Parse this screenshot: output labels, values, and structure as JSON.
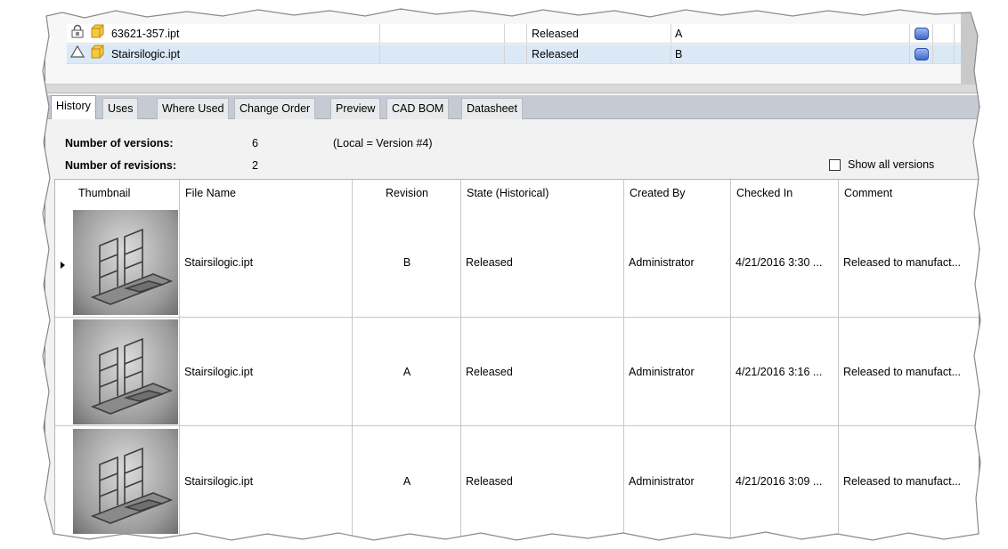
{
  "top_list": {
    "rows": [
      {
        "name": "63621-357.ipt",
        "state": "Released",
        "revision": "A",
        "lock_icon": "lock-icon",
        "file_icon": "cube-icon"
      },
      {
        "name": "Stairsilogic.ipt",
        "state": "Released",
        "revision": "B",
        "status_icon": "triangle-icon",
        "file_icon": "cube-icon"
      }
    ]
  },
  "tabs": [
    "History",
    "Uses",
    "Where Used",
    "Change Order",
    "Preview",
    "CAD BOM",
    "Datasheet"
  ],
  "history": {
    "versions_label": "Number of versions:",
    "versions_value": "6",
    "local_note": "(Local = Version #4)",
    "revisions_label": "Number of revisions:",
    "revisions_value": "2",
    "show_all_label": "Show all versions",
    "show_all_checked": false
  },
  "grid": {
    "columns": [
      "Thumbnail",
      "File Name",
      "Revision",
      "State (Historical)",
      "Created By",
      "Checked In",
      "Comment"
    ],
    "rows": [
      {
        "file": "Stairsilogic.ipt",
        "revision": "B",
        "state": "Released",
        "created_by": "Administrator",
        "checked_in": "4/21/2016 3:30 ...",
        "comment": "Released to manufact..."
      },
      {
        "file": "Stairsilogic.ipt",
        "revision": "A",
        "state": "Released",
        "created_by": "Administrator",
        "checked_in": "4/21/2016 3:16 ...",
        "comment": "Released to manufact..."
      },
      {
        "file": "Stairsilogic.ipt",
        "revision": "A",
        "state": "Released",
        "created_by": "Administrator",
        "checked_in": "4/21/2016 3:09 ...",
        "comment": "Released to manufact..."
      }
    ]
  },
  "colors": {
    "selected_row": "#dbe8f6",
    "tab_strip": "#c6cbd3",
    "status_icon_blue": "#3f68c9",
    "folder_yellow": "#f5c842"
  }
}
